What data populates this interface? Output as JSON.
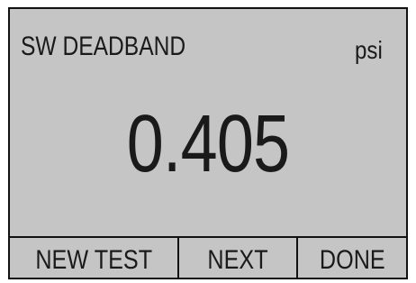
{
  "display": {
    "mode_title": "SW DEADBAND",
    "unit": "psi",
    "reading": "0.405"
  },
  "softkeys": [
    {
      "label": "NEW TEST"
    },
    {
      "label": "NEXT"
    },
    {
      "label": "DONE"
    }
  ],
  "colors": {
    "screen_background": "#c5c5c5",
    "text": "#1a1a1a",
    "border": "#111111"
  }
}
